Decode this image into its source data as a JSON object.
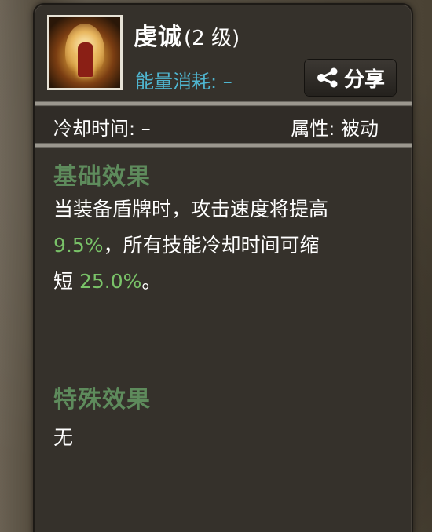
{
  "skill": {
    "name": "虔诚",
    "level": "(2 级)",
    "energy_cost": "能量消耗: –",
    "icon": "holy-figure-skill-icon"
  },
  "share_button": {
    "label": "分享",
    "icon": "share-icon"
  },
  "stats": {
    "cooldown": "冷却时间: –",
    "attribute": "属性: 被动"
  },
  "base_effect": {
    "heading": "基础效果",
    "line1": "当装备盾牌时，攻击速度将提高",
    "attack_speed_value": "9.5%",
    "line2_rest": "，所有技能冷却时间可缩",
    "line3_prefix": "短 ",
    "cooldown_reduction_value": "25.0%",
    "line3_suffix": "。"
  },
  "special_effect": {
    "heading": "特殊效果",
    "text": "无"
  },
  "colors": {
    "panel_bg": "#35312b",
    "energy": "#4fb5cf",
    "heading_green": "#5e8b5c",
    "value_green": "#79c268"
  }
}
